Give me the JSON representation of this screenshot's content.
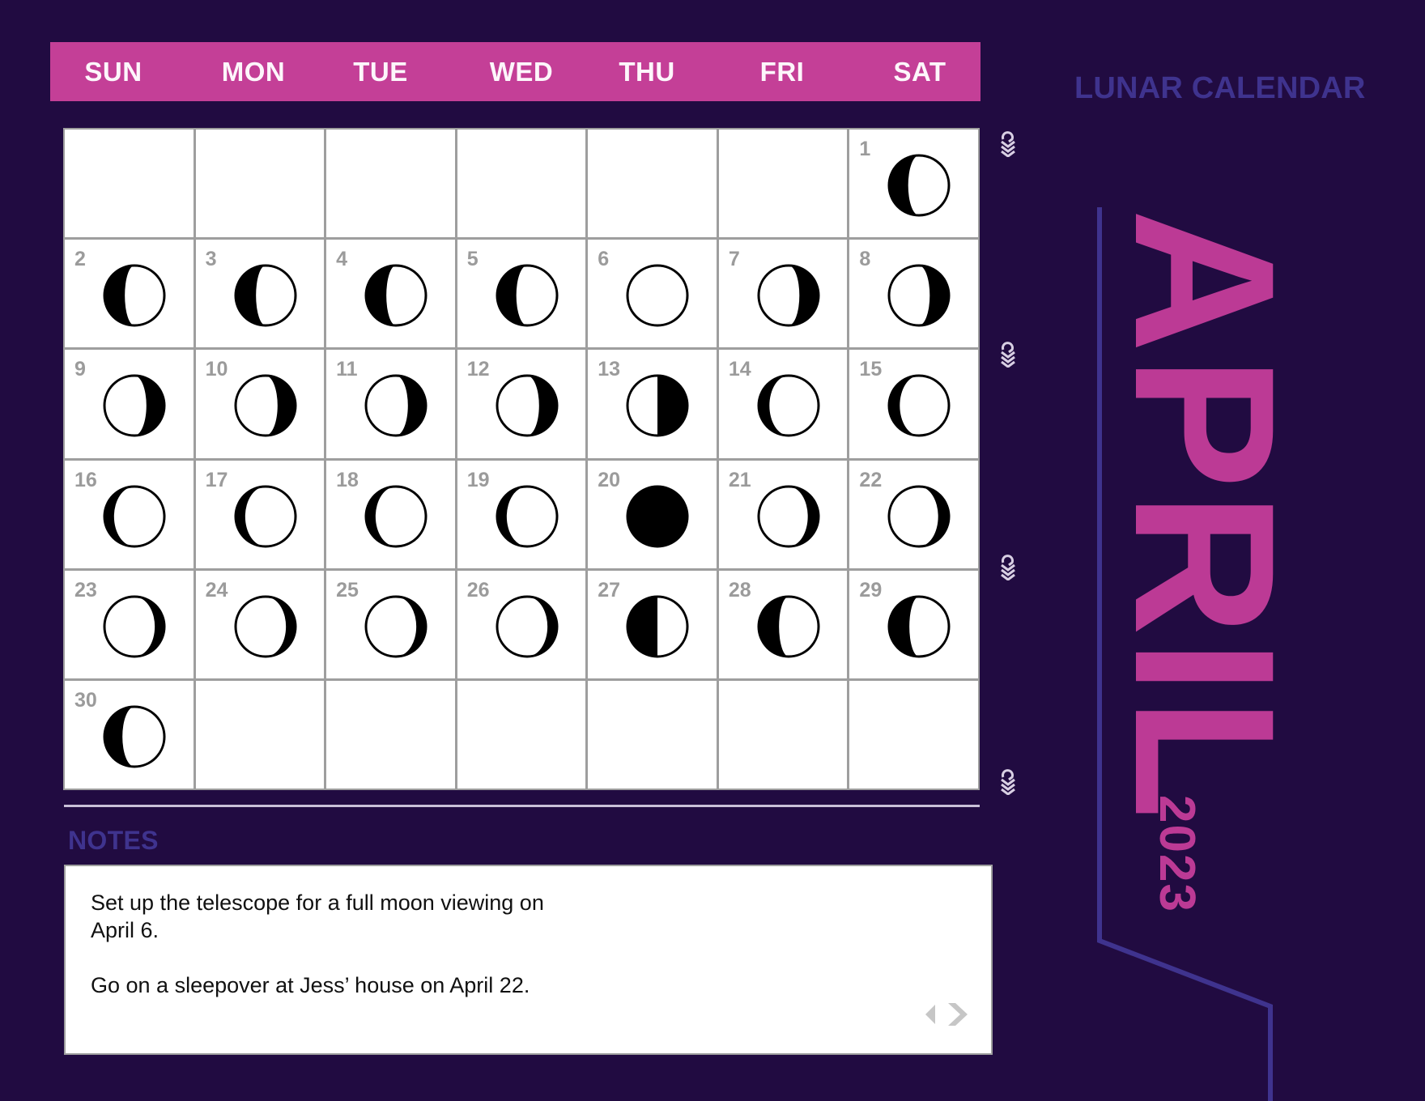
{
  "title": "LUNAR CALENDAR",
  "month": "APRIL",
  "year": "2023",
  "colors": {
    "background": "#210b41",
    "accent": "#c43f97",
    "title": "#3f338e",
    "day_number": "#9b9b9b",
    "moon_dark": "#000000",
    "moon_light": "#ffffff"
  },
  "weekdays": [
    "SUN",
    "MON",
    "TUE",
    "WED",
    "THU",
    "FRI",
    "SAT"
  ],
  "first_weekday_index": 6,
  "days": [
    {
      "day": "1",
      "phase": "waxing-gibbous-shadow",
      "shadow": "left",
      "shadow_fraction": 0.32
    },
    {
      "day": "2",
      "phase": "waxing-gibbous-shadow",
      "shadow": "left",
      "shadow_fraction": 0.34
    },
    {
      "day": "3",
      "phase": "waxing-gibbous-shadow",
      "shadow": "left",
      "shadow_fraction": 0.34
    },
    {
      "day": "4",
      "phase": "waxing-gibbous-shadow",
      "shadow": "left",
      "shadow_fraction": 0.34
    },
    {
      "day": "5",
      "phase": "waxing-gibbous-shadow",
      "shadow": "left",
      "shadow_fraction": 0.32
    },
    {
      "day": "6",
      "phase": "full-moon",
      "shadow": "none",
      "shadow_fraction": 0
    },
    {
      "day": "7",
      "phase": "waning-gibbous",
      "shadow": "right",
      "shadow_fraction": 0.32
    },
    {
      "day": "8",
      "phase": "waning-gibbous",
      "shadow": "right",
      "shadow_fraction": 0.32
    },
    {
      "day": "9",
      "phase": "waning-gibbous",
      "shadow": "right",
      "shadow_fraction": 0.3
    },
    {
      "day": "10",
      "phase": "waning-gibbous",
      "shadow": "right",
      "shadow_fraction": 0.3
    },
    {
      "day": "11",
      "phase": "waning-gibbous",
      "shadow": "right",
      "shadow_fraction": 0.3
    },
    {
      "day": "12",
      "phase": "waning-gibbous",
      "shadow": "right",
      "shadow_fraction": 0.3
    },
    {
      "day": "13",
      "phase": "last-quarter",
      "shadow": "right",
      "shadow_fraction": 0.5
    },
    {
      "day": "14",
      "phase": "crescent-shadow",
      "shadow": "left",
      "shadow_fraction": 0.18
    },
    {
      "day": "15",
      "phase": "crescent-shadow",
      "shadow": "left",
      "shadow_fraction": 0.18
    },
    {
      "day": "16",
      "phase": "crescent-shadow",
      "shadow": "left",
      "shadow_fraction": 0.16
    },
    {
      "day": "17",
      "phase": "crescent-shadow",
      "shadow": "left",
      "shadow_fraction": 0.16
    },
    {
      "day": "18",
      "phase": "crescent-shadow",
      "shadow": "left",
      "shadow_fraction": 0.16
    },
    {
      "day": "19",
      "phase": "crescent-shadow",
      "shadow": "left",
      "shadow_fraction": 0.16
    },
    {
      "day": "20",
      "phase": "new-moon",
      "shadow": "full",
      "shadow_fraction": 1
    },
    {
      "day": "21",
      "phase": "crescent-shadow",
      "shadow": "right",
      "shadow_fraction": 0.18
    },
    {
      "day": "22",
      "phase": "crescent-shadow",
      "shadow": "right",
      "shadow_fraction": 0.18
    },
    {
      "day": "23",
      "phase": "crescent-shadow",
      "shadow": "right",
      "shadow_fraction": 0.16
    },
    {
      "day": "24",
      "phase": "crescent-shadow",
      "shadow": "right",
      "shadow_fraction": 0.16
    },
    {
      "day": "25",
      "phase": "crescent-shadow",
      "shadow": "right",
      "shadow_fraction": 0.16
    },
    {
      "day": "26",
      "phase": "crescent-shadow",
      "shadow": "right",
      "shadow_fraction": 0.16
    },
    {
      "day": "27",
      "phase": "first-quarter",
      "shadow": "left",
      "shadow_fraction": 0.5
    },
    {
      "day": "28",
      "phase": "gibbous-shadow",
      "shadow": "left",
      "shadow_fraction": 0.34
    },
    {
      "day": "29",
      "phase": "gibbous-shadow",
      "shadow": "left",
      "shadow_fraction": 0.34
    },
    {
      "day": "30",
      "phase": "gibbous-shadow",
      "shadow": "left",
      "shadow_fraction": 0.3
    }
  ],
  "notes": {
    "label": "NOTES",
    "paragraphs": [
      "Set up the telescope for a full moon viewing on April 6.",
      "Go on a sleepover at Jess’ house on April 22."
    ],
    "prev_icon": "chevron-left-icon",
    "next_icon": "chevron-right-icon"
  },
  "binding_rings": [
    "ring",
    "ring",
    "ring",
    "ring"
  ]
}
